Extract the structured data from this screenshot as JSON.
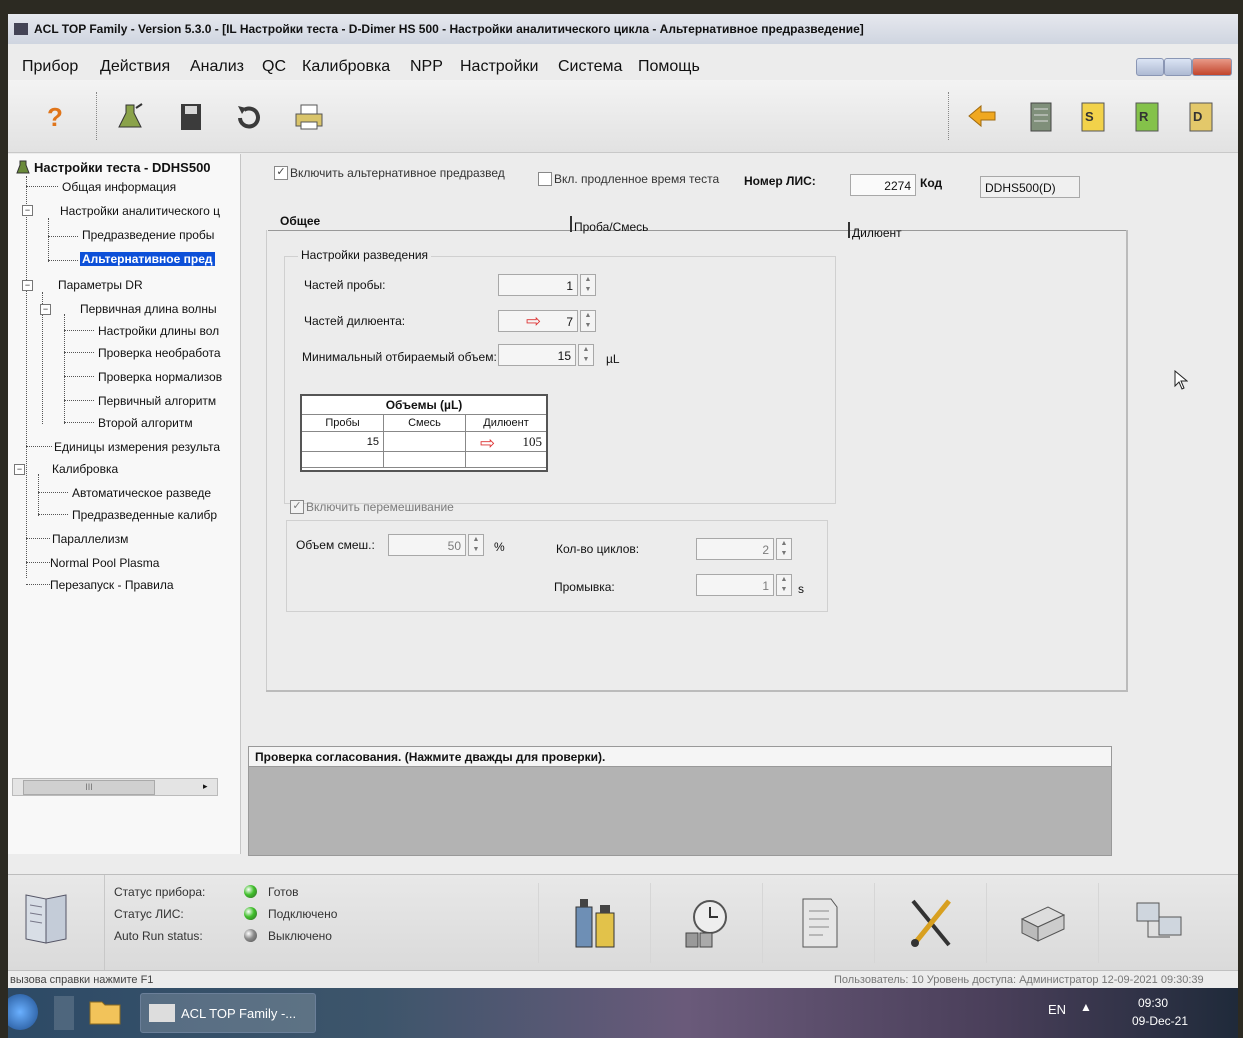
{
  "window": {
    "title": "ACL TOP Family - Version 5.3.0 - [IL Настройки теста - D-Dimer HS 500 - Настройки аналитического цикла - Альтернативное предразведение]"
  },
  "menu": [
    "Прибор",
    "Действия",
    "Анализ",
    "QC",
    "Калибровка",
    "NPP",
    "Настройки",
    "Система",
    "Помощь"
  ],
  "toolbar": {
    "left_icons": [
      "help-icon",
      "flask-icon",
      "save-icon",
      "refresh-icon",
      "printer-icon"
    ],
    "right_icons": [
      "back-arrow-icon",
      "list-icon",
      "s-page-icon",
      "r-page-icon",
      "d-page-icon"
    ],
    "right_letters": [
      "S",
      "R",
      "D"
    ]
  },
  "tree": {
    "root": "Настройки теста - DDHS500",
    "items": [
      {
        "label": "Общая информация"
      },
      {
        "label": "Настройки аналитического ц"
      },
      {
        "label": "Предразведение пробы"
      },
      {
        "label": "Альтернативное пред",
        "selected": true
      },
      {
        "label": "Параметры DR"
      },
      {
        "label": "Первичная длина волны"
      },
      {
        "label": "Настройки длины вол"
      },
      {
        "label": "Проверка необработа"
      },
      {
        "label": "Проверка нормализов"
      },
      {
        "label": "Первичный алгоритм"
      },
      {
        "label": "Второй алгоритм"
      },
      {
        "label": "Единицы измерения результа"
      },
      {
        "label": "Калибровка"
      },
      {
        "label": "Автоматическое разведе"
      },
      {
        "label": "Предразведенные калибр"
      },
      {
        "label": "Параллелизм"
      },
      {
        "label": "Normal Pool Plasma"
      },
      {
        "label": "Перезапуск - Правила"
      }
    ],
    "scroll_thumb": "III"
  },
  "top": {
    "alt_predilution_label": "Включить альтернативное предразвед",
    "alt_predilution_checked": true,
    "extended_time_label": "Вкл. продленное время теста",
    "extended_time_checked": false,
    "lis_label": "Номер ЛИС:",
    "lis_value": "2274",
    "code_label": "Код",
    "code_value": "DDHS500(D)"
  },
  "tabs": [
    "Общее",
    "Проба/Смесь",
    "Дилюент"
  ],
  "dilution": {
    "group_title": "Настройки разведения",
    "sample_parts_label": "Частей пробы:",
    "sample_parts_value": "1",
    "diluent_parts_label": "Частей дилюента:",
    "diluent_parts_value": "7",
    "min_volume_label": "Минимальный отбираемый объем:",
    "min_volume_value": "15",
    "min_volume_unit": "µL"
  },
  "volumes_table": {
    "title": "Объемы (µL)",
    "headers": [
      "Пробы",
      "Смесь",
      "Дилюент"
    ],
    "rows": [
      [
        "15",
        "",
        "105"
      ]
    ]
  },
  "mixing": {
    "enable_label": "Включить перемешивание",
    "enable_checked": true,
    "volume_label": "Объем смеш.:",
    "volume_value": "50",
    "volume_unit": "%",
    "cycles_label": "Кол-во циклов:",
    "cycles_value": "2",
    "wash_label": "Промывка:",
    "wash_value": "1",
    "wash_unit": "s"
  },
  "check_panel": {
    "header": "Проверка согласования. (Нажмите дважды для проверки)."
  },
  "status": {
    "instrument_label": "Статус прибора:",
    "instrument_value": "Готов",
    "lis_label": "Статус ЛИС:",
    "lis_value": "Подключено",
    "autorun_label": "Auto Run status:",
    "autorun_value": "Выключено",
    "led_colors": [
      "#3fbf2a",
      "#3fbf2a",
      "#8a8a8a"
    ],
    "icons": [
      "reagent-bottles-icon",
      "clock-samples-icon",
      "report-sheet-icon",
      "tools-icon",
      "printer-status-icon",
      "network-computers-icon"
    ]
  },
  "hint": {
    "left": "вызова справки нажмите F1",
    "right": "Пользователь: 10  Уровень доступа: Администратор  12-09-2021 09:30:39"
  },
  "taskbar": {
    "task_label": "ACL TOP Family -...",
    "lang": "EN",
    "time": "09:30",
    "date": "09-Dec-21"
  }
}
